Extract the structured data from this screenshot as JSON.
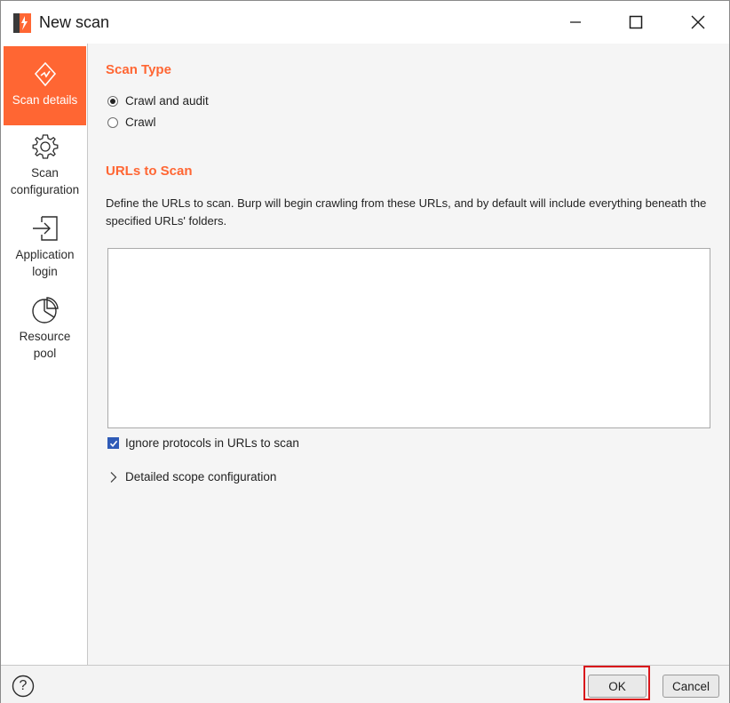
{
  "window": {
    "title": "New scan",
    "accent_color": "#ff6633"
  },
  "sidebar": {
    "items": [
      {
        "label": "Scan details",
        "icon": "scan-details-icon",
        "active": true
      },
      {
        "label_line1": "Scan",
        "label_line2": "configuration",
        "icon": "gear-icon",
        "active": false
      },
      {
        "label_line1": "Application",
        "label_line2": "login",
        "icon": "login-icon",
        "active": false
      },
      {
        "label_line1": "Resource",
        "label_line2": "pool",
        "icon": "pie-chart-icon",
        "active": false
      }
    ]
  },
  "scan_type": {
    "heading": "Scan Type",
    "options": [
      {
        "label": "Crawl and audit",
        "selected": true
      },
      {
        "label": "Crawl",
        "selected": false
      }
    ]
  },
  "urls": {
    "heading": "URLs to Scan",
    "description": "Define the URLs to scan. Burp will begin crawling from these URLs, and by default will include everything beneath the specified URLs' folders.",
    "value": "",
    "ignore_protocols_label": "Ignore protocols in URLs to scan",
    "ignore_protocols_checked": true,
    "detailed_scope_label": "Detailed scope configuration"
  },
  "footer": {
    "help_label": "?",
    "ok_label": "OK",
    "cancel_label": "Cancel",
    "highlight_color": "#d9161b"
  }
}
